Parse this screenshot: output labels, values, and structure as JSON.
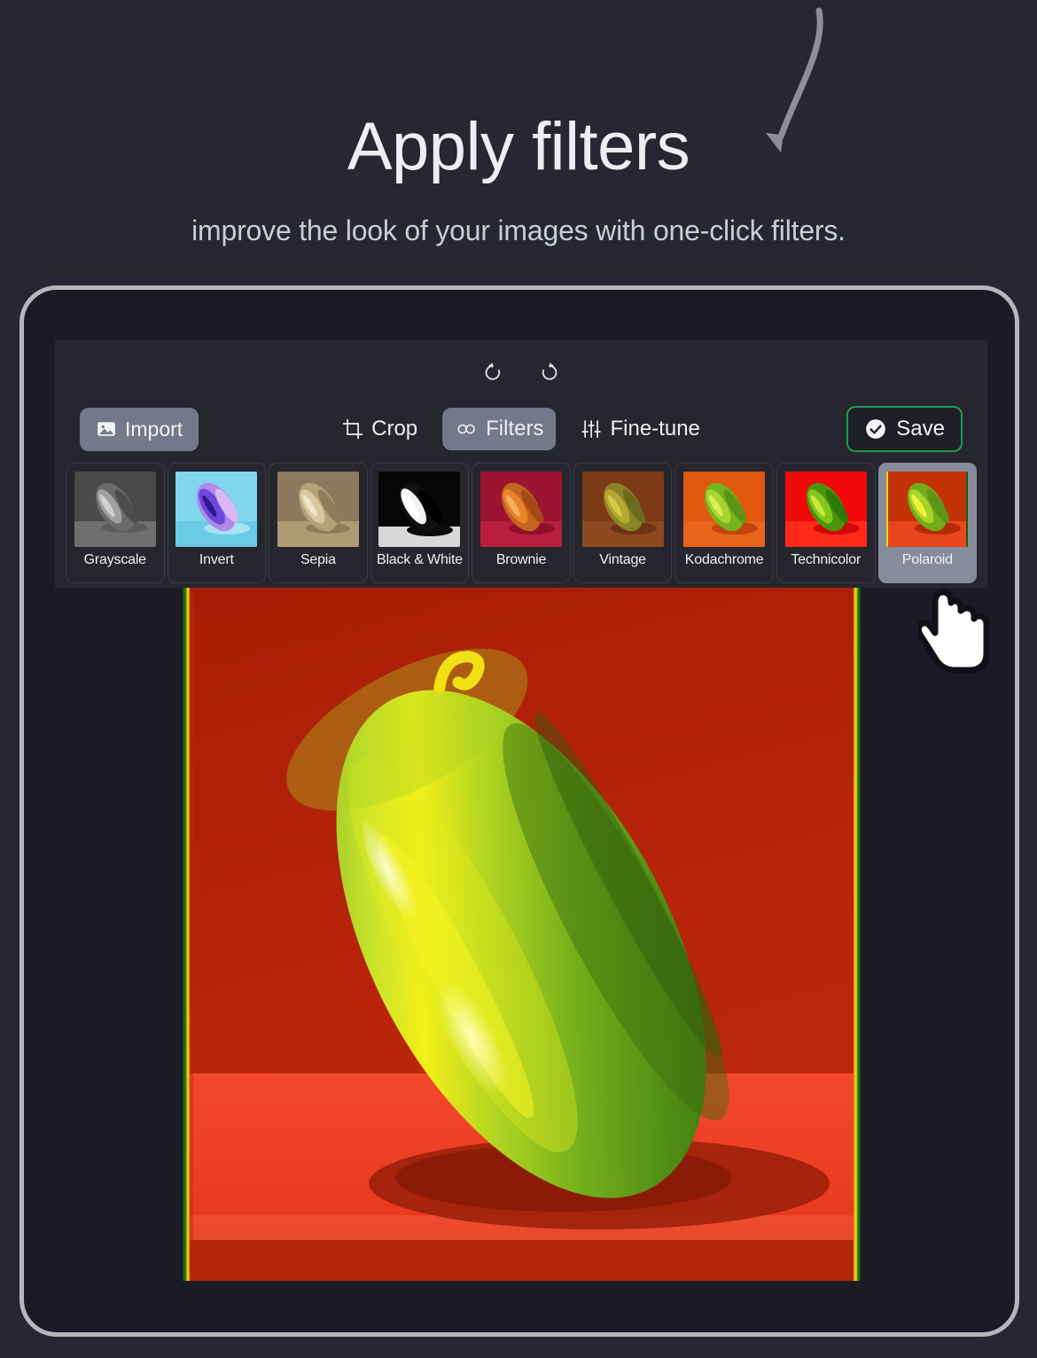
{
  "hero": {
    "title": "Apply filters",
    "subtitle": "improve the look of your images with one-click filters.",
    "arrow_icon": "curved-arrow-down-left-icon"
  },
  "colors": {
    "page_background": "#272733",
    "device_border": "#b6b6bb",
    "device_inner": "#1b1b27",
    "panel_background": "#26262f",
    "accent_button": "#73798a",
    "save_border_green": "#1f9d54",
    "text_primary": "#eceef2",
    "text_secondary": "#c9cdd6",
    "selected_item": "#868c99"
  },
  "editor": {
    "history": [
      {
        "name": "undo-button",
        "icon": "undo-icon",
        "label": "Undo"
      },
      {
        "name": "redo-button",
        "icon": "redo-icon",
        "label": "Redo"
      }
    ],
    "import_button": {
      "label": "Import",
      "icon": "image-icon"
    },
    "save_button": {
      "label": "Save",
      "icon": "check-circle-icon"
    },
    "tabs": [
      {
        "label": "Crop",
        "icon": "crop-icon",
        "active": false
      },
      {
        "label": "Filters",
        "icon": "filters-icon",
        "active": true
      },
      {
        "label": "Fine-tune",
        "icon": "sliders-icon",
        "active": false
      }
    ],
    "selected_filter": "Polaroid",
    "filters": [
      {
        "label": "Grayscale",
        "selected": false,
        "bg": "#4a4a4a",
        "body_light": "#9a9a9a",
        "body_dark": "#3a3a3a",
        "highlight": "#d6d6d6",
        "floor": "#7d7d7d"
      },
      {
        "label": "Invert",
        "selected": false,
        "bg": "#7fd6ee",
        "body_light": "#c9a7f2",
        "body_dark": "#5b3fcf",
        "highlight": "#efe0ff",
        "floor": "#66cde8"
      },
      {
        "label": "Sepia",
        "selected": false,
        "bg": "#8c7a5c",
        "body_light": "#d8c49c",
        "body_dark": "#7a6847",
        "highlight": "#f0e3c6",
        "floor": "#b8a customer"
      },
      {
        "label": "Black & White",
        "selected": false,
        "bg": "#0a0a0a",
        "body_light": "#ffffff",
        "body_dark": "#050505",
        "highlight": "#ffffff",
        "floor": "#3a3a3a"
      },
      {
        "label": "Brownie",
        "selected": false,
        "bg": "#9c1530",
        "body_light": "#e8832a",
        "body_dark": "#b4541a",
        "highlight": "#f2a84e",
        "floor": "#b81f3c"
      },
      {
        "label": "Vintage",
        "selected": false,
        "bg": "#7d3a16",
        "body_light": "#b0a62e",
        "body_dark": "#6e7a1f",
        "highlight": "#d4c84a",
        "floor": "#8c4a1e"
      },
      {
        "label": "Kodachrome",
        "selected": false,
        "bg": "#e0590f",
        "body_light": "#9dd12c",
        "body_dark": "#5f9a19",
        "highlight": "#d4f05a",
        "floor": "#e8641a"
      },
      {
        "label": "Technicolor",
        "selected": false,
        "bg": "#f00a0a",
        "body_light": "#7dc718",
        "body_dark": "#2e7a0a",
        "highlight": "#c8e83c",
        "floor": "#ff2a1a"
      },
      {
        "label": "Polaroid",
        "selected": true,
        "bg": "#c43208",
        "body_light": "#9fd32a",
        "body_dark": "#5e9417",
        "highlight": "#f2f23a",
        "floor": "#e8461c"
      }
    ]
  },
  "canvas": {
    "image_alt": "cucumber on red surface with polaroid filter applied",
    "filter_applied": "Polaroid",
    "bg_top": "#b01f07",
    "bg_floor": "#f2442a",
    "fringe_left": [
      "#1e5a0e",
      "#f2d81a",
      "#d4a010"
    ],
    "fringe_right": [
      "#f2d81a",
      "#1e5a0e"
    ]
  },
  "cursor": {
    "icon": "pointing-hand-cursor-icon"
  }
}
